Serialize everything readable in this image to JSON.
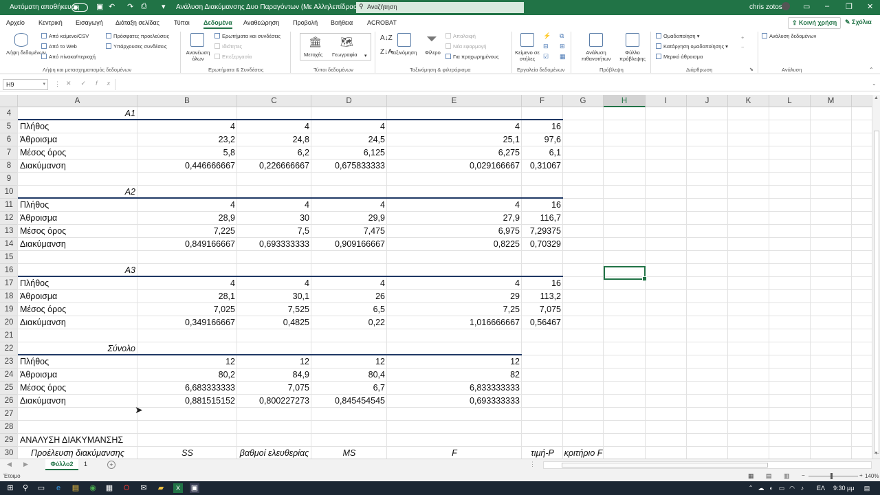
{
  "titlebar": {
    "autosave_label": "Αυτόματη αποθήκευση",
    "title": "Ανάλυση Διακύμανσης Δυο Παραγόντων (Με Αλληλεπίδραση) - Excel",
    "search_placeholder": "Αναζήτηση",
    "user": "chris zotos"
  },
  "ribbon_tabs": [
    "Αρχείο",
    "Κεντρική",
    "Εισαγωγή",
    "Διάταξη σελίδας",
    "Τύποι",
    "Δεδομένα",
    "Αναθεώρηση",
    "Προβολή",
    "Βοήθεια",
    "ACROBAT"
  ],
  "share_label": "Κοινή χρήση",
  "comments_label": "Σχόλια",
  "ribbon": {
    "get_data": "Λήψη δεδομένων",
    "from_text": "Από κείμενο/CSV",
    "from_web": "Από το Web",
    "from_table": "Από πίνακα/περιοχή",
    "recent_sources": "Πρόσφατες προελεύσεις",
    "existing_conn": "Υπάρχουσες συνδέσεις",
    "group_get": "Λήψη και μετασχηματισμός δεδομένων",
    "refresh_all": "Ανανέωση όλων",
    "queries_conn": "Ερωτήματα και συνδέσεις",
    "properties": "Ιδιότητες",
    "edit_links": "Επεξεργασία",
    "group_queries": "Ερωτήματα & Συνδέσεις",
    "stocks": "Μετοχές",
    "geography": "Γεωγραφία",
    "group_types": "Τύποι δεδομένων",
    "sort": "Ταξινόμηση",
    "filter": "Φίλτρο",
    "clear": "Απαλοιφή",
    "reapply": "Νέα εφαρμογή",
    "advanced": "Για προχωρημένους",
    "group_sort": "Ταξινόμηση & φιλτράρισμα",
    "text_to_cols": "Κείμενο σε στήλες",
    "group_tools": "Εργαλεία δεδομένων",
    "what_if": "Ανάλυση πιθανοτήτων",
    "forecast_sheet": "Φύλλο πρόβλεψης",
    "group_forecast": "Πρόβλεψη",
    "group_btn": "Ομαδοποίηση",
    "ungroup_btn": "Κατάργηση ομαδοποίησης",
    "subtotal": "Μερικό άθροισμα",
    "group_outline": "Διάρθρωση",
    "data_analysis": "Ανάλυση δεδομένων",
    "group_analysis": "Ανάλυση"
  },
  "namebox": "H9",
  "columns": [
    "A",
    "B",
    "C",
    "D",
    "E",
    "F",
    "G",
    "H",
    "I",
    "J",
    "K",
    "L",
    "M"
  ],
  "rows": [
    {
      "n": "4",
      "a": "A1",
      "aStyle": "ir",
      "b": "",
      "c": "",
      "d": "",
      "e": "",
      "f": ""
    },
    {
      "n": "5",
      "a": "Πλήθος",
      "b": "4",
      "c": "4",
      "d": "4",
      "e": "4",
      "f": "16"
    },
    {
      "n": "6",
      "a": "Άθροισμα",
      "b": "23,2",
      "c": "24,8",
      "d": "24,5",
      "e": "25,1",
      "f": "97,6"
    },
    {
      "n": "7",
      "a": "Μέσος όρος",
      "b": "5,8",
      "c": "6,2",
      "d": "6,125",
      "e": "6,275",
      "f": "6,1"
    },
    {
      "n": "8",
      "a": "Διακύμανση",
      "b": "0,446666667",
      "c": "0,226666667",
      "d": "0,675833333",
      "e": "0,029166667",
      "f": "0,31067"
    },
    {
      "n": "9",
      "a": "",
      "b": "",
      "c": "",
      "d": "",
      "e": "",
      "f": ""
    },
    {
      "n": "10",
      "a": "A2",
      "aStyle": "ir",
      "b": "",
      "c": "",
      "d": "",
      "e": "",
      "f": ""
    },
    {
      "n": "11",
      "a": "Πλήθος",
      "b": "4",
      "c": "4",
      "d": "4",
      "e": "4",
      "f": "16"
    },
    {
      "n": "12",
      "a": "Άθροισμα",
      "b": "28,9",
      "c": "30",
      "d": "29,9",
      "e": "27,9",
      "f": "116,7"
    },
    {
      "n": "13",
      "a": "Μέσος όρος",
      "b": "7,225",
      "c": "7,5",
      "d": "7,475",
      "e": "6,975",
      "f": "7,29375"
    },
    {
      "n": "14",
      "a": "Διακύμανση",
      "b": "0,849166667",
      "c": "0,693333333",
      "d": "0,909166667",
      "e": "0,8225",
      "f": "0,70329"
    },
    {
      "n": "15",
      "a": "",
      "b": "",
      "c": "",
      "d": "",
      "e": "",
      "f": ""
    },
    {
      "n": "16",
      "a": "A3",
      "aStyle": "ir",
      "b": "",
      "c": "",
      "d": "",
      "e": "",
      "f": ""
    },
    {
      "n": "17",
      "a": "Πλήθος",
      "b": "4",
      "c": "4",
      "d": "4",
      "e": "4",
      "f": "16"
    },
    {
      "n": "18",
      "a": "Άθροισμα",
      "b": "28,1",
      "c": "30,1",
      "d": "26",
      "e": "29",
      "f": "113,2"
    },
    {
      "n": "19",
      "a": "Μέσος όρος",
      "b": "7,025",
      "c": "7,525",
      "d": "6,5",
      "e": "7,25",
      "f": "7,075"
    },
    {
      "n": "20",
      "a": "Διακύμανση",
      "b": "0,349166667",
      "c": "0,4825",
      "d": "0,22",
      "e": "1,016666667",
      "f": "0,56467"
    },
    {
      "n": "21",
      "a": "",
      "b": "",
      "c": "",
      "d": "",
      "e": "",
      "f": ""
    },
    {
      "n": "22",
      "a": "Σύνολο",
      "aStyle": "ir",
      "b": "",
      "c": "",
      "d": "",
      "e": "",
      "f": ""
    },
    {
      "n": "23",
      "a": "Πλήθος",
      "b": "12",
      "c": "12",
      "d": "12",
      "e": "12",
      "f": ""
    },
    {
      "n": "24",
      "a": "Άθροισμα",
      "b": "80,2",
      "c": "84,9",
      "d": "80,4",
      "e": "82",
      "f": ""
    },
    {
      "n": "25",
      "a": "Μέσος όρος",
      "b": "6,683333333",
      "c": "7,075",
      "d": "6,7",
      "e": "6,833333333",
      "f": ""
    },
    {
      "n": "26",
      "a": "Διακύμανση",
      "b": "0,881515152",
      "c": "0,800227273",
      "d": "0,845454545",
      "e": "0,693333333",
      "f": ""
    },
    {
      "n": "27",
      "a": "",
      "b": "",
      "c": "",
      "d": "",
      "e": "",
      "f": ""
    },
    {
      "n": "28",
      "a": "",
      "b": "",
      "c": "",
      "d": "",
      "e": "",
      "f": ""
    },
    {
      "n": "29",
      "a": "ΑΝΑΛΥΣΗ ΔΙΑΚΥΜΑΝΣΗΣ",
      "b": "",
      "c": "",
      "d": "",
      "e": "",
      "f": ""
    },
    {
      "n": "30",
      "a": "Προέλευση διακύμανσης",
      "aStyle": "ic",
      "b": "SS",
      "c": "βαθμοί ελευθερίας",
      "d": "MS",
      "e": "F",
      "f": "τιμή-P",
      "g": "κριτήριο F",
      "hdr": true
    }
  ],
  "sheet_tabs": [
    "Φύλλο2",
    "1"
  ],
  "status": {
    "ready": "Έτοιμο",
    "zoom": "140%"
  },
  "taskbar": {
    "time": "9:30 μμ",
    "lang": "ΕΛ"
  }
}
